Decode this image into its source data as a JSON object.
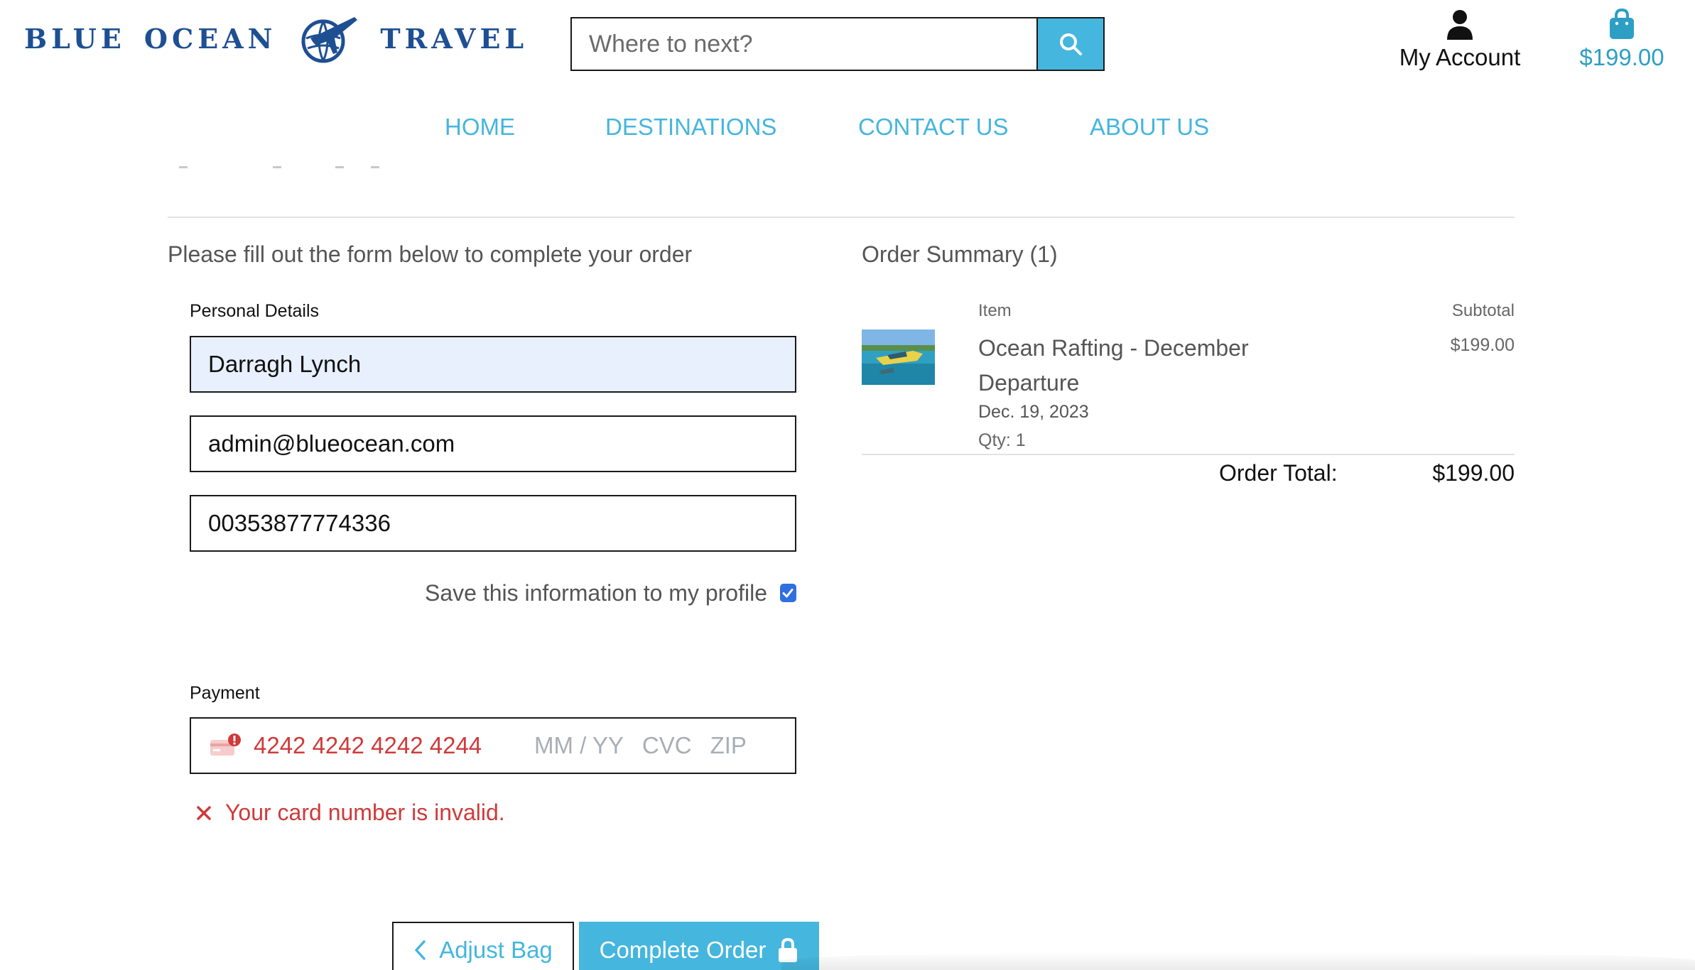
{
  "brand": {
    "word1": "BLUE",
    "word2": "OCEAN",
    "word3": "TRAVEL",
    "logo_icon": "globe-plane-icon",
    "color": "#1e4f93"
  },
  "search": {
    "placeholder": "Where to next?",
    "icon": "search-icon"
  },
  "header": {
    "account_label": "My Account",
    "bag_total": "$199.00"
  },
  "nav": {
    "items": [
      {
        "label": "HOME"
      },
      {
        "label": "DESTINATIONS"
      },
      {
        "label": "CONTACT US"
      },
      {
        "label": "ABOUT US"
      }
    ]
  },
  "colors": {
    "accent": "#45b6dd",
    "error": "#cf3a3a",
    "checkbox": "#2f6fe0",
    "autofill": "#e8effd"
  },
  "form": {
    "intro": "Please fill out the form below to complete your order",
    "personal_label": "Personal Details",
    "full_name": "Darragh Lynch",
    "email": "admin@blueocean.com",
    "phone": "00353877774336",
    "save_label": "Save this information to my profile",
    "save_checked": true,
    "payment_label": "Payment",
    "card_number": "4242 4242 4242 4244",
    "expiry_placeholder": "MM / YY",
    "cvc_placeholder": "CVC",
    "zip_placeholder": "ZIP",
    "card_error": "Your card number is invalid.",
    "adjust_bag_label": "Adjust Bag",
    "complete_order_label": "Complete Order"
  },
  "summary": {
    "title": "Order Summary (1)",
    "col_item": "Item",
    "col_subtotal": "Subtotal",
    "item": {
      "name": "Ocean Rafting - December Departure",
      "date": "Dec. 19, 2023",
      "qty": "Qty: 1",
      "subtotal": "$199.00"
    },
    "total_label": "Order Total:",
    "total_value": "$199.00"
  }
}
